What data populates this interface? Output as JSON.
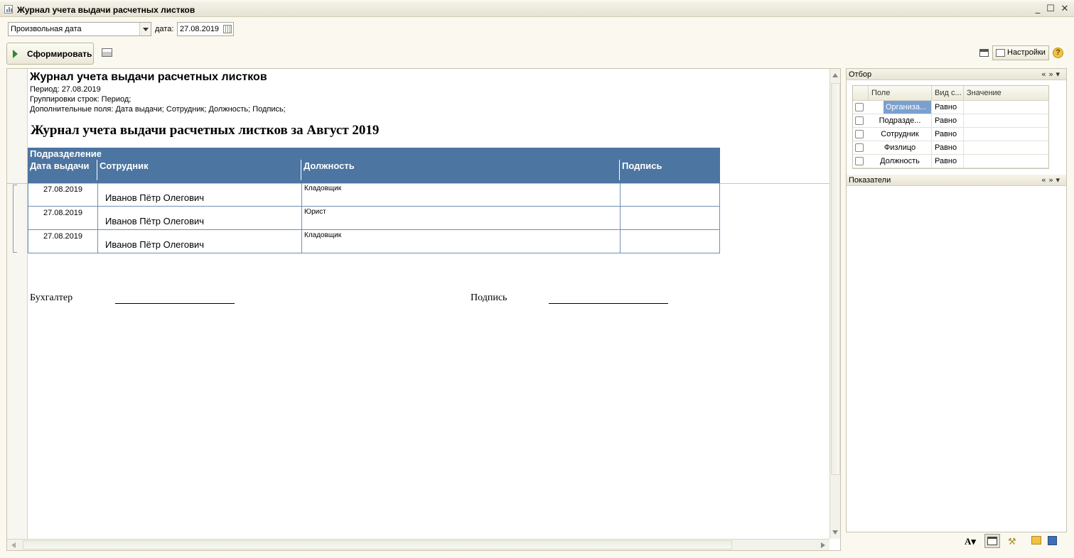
{
  "window": {
    "title": "Журнал учета выдачи расчетных листков",
    "minimize": "_",
    "maximize": "☐",
    "close": "✕"
  },
  "params": {
    "period_type": "Произвольная дата",
    "date_label": "дата:",
    "date_value": "27.08.2019"
  },
  "toolbar": {
    "generate_label": "Сформировать",
    "settings_label": "Настройки",
    "help": "?"
  },
  "report": {
    "title": "Журнал учета выдачи расчетных листков",
    "period": "Период: 27.08.2019",
    "grouping": "Группировки строк: Период;",
    "extra_fields": "Дополнительные поля: Дата выдачи; Сотрудник; Должность; Подпись;",
    "heading": "Журнал учета выдачи расчетных листков за Август 2019",
    "group_header": "Подразделение",
    "columns": [
      "Дата выдачи",
      "Сотрудник",
      "Должность",
      "Подпись"
    ],
    "rows": [
      {
        "date": "27.08.2019",
        "employee": "Иванов Пётр Олегович",
        "position": "Кладовщик",
        "signature": ""
      },
      {
        "date": "27.08.2019",
        "employee": "Иванов Пётр Олегович",
        "position": "Юрист",
        "signature": ""
      },
      {
        "date": "27.08.2019",
        "employee": "Иванов Пётр Олегович",
        "position": "Кладовщик",
        "signature": ""
      }
    ],
    "footer_accountant": "Бухгалтер",
    "footer_signature": "Подпись"
  },
  "filter_panel": {
    "title": "Отбор",
    "collapse_controls": "« » ▾",
    "columns": [
      "Поле",
      "Вид с...",
      "Значение"
    ],
    "rows": [
      {
        "field": "Организа...",
        "condition": "Равно",
        "value": ""
      },
      {
        "field": "Подразде...",
        "condition": "Равно",
        "value": ""
      },
      {
        "field": "Сотрудник",
        "condition": "Равно",
        "value": ""
      },
      {
        "field": "Физлицо",
        "condition": "Равно",
        "value": ""
      },
      {
        "field": "Должность",
        "condition": "Равно",
        "value": ""
      }
    ]
  },
  "indicators_panel": {
    "title": "Показатели",
    "collapse_controls": "« » ▾"
  },
  "colors": {
    "table_header": "#4c75a1",
    "selected_cell": "#7aa0d0",
    "window_bg": "#fbf9ef"
  }
}
